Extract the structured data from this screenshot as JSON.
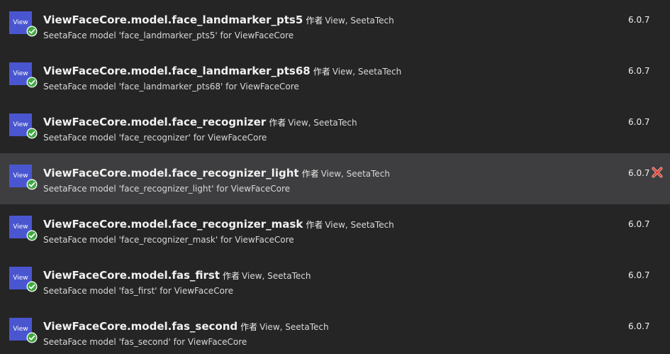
{
  "packages": [
    {
      "logo_text": "View",
      "name": "ViewFaceCore.model.face_landmarker_pts5",
      "by_label": "作者",
      "authors": "View, SeetaTech",
      "description": "SeetaFace model 'face_landmarker_pts5' for ViewFaceCore",
      "version": "6.0.7"
    },
    {
      "logo_text": "View",
      "name": "ViewFaceCore.model.face_landmarker_pts68",
      "by_label": "作者",
      "authors": "View, SeetaTech",
      "description": "SeetaFace model 'face_landmarker_pts68' for ViewFaceCore",
      "version": "6.0.7"
    },
    {
      "logo_text": "View",
      "name": "ViewFaceCore.model.face_recognizer",
      "by_label": "作者",
      "authors": "View, SeetaTech",
      "description": "SeetaFace model 'face_recognizer' for ViewFaceCore",
      "version": "6.0.7"
    },
    {
      "logo_text": "View",
      "name": "ViewFaceCore.model.face_recognizer_light",
      "by_label": "作者",
      "authors": "View, SeetaTech",
      "description": "SeetaFace model 'face_recognizer_light' for ViewFaceCore",
      "version": "6.0.7"
    },
    {
      "logo_text": "View",
      "name": "ViewFaceCore.model.face_recognizer_mask",
      "by_label": "作者",
      "authors": "View, SeetaTech",
      "description": "SeetaFace model 'face_recognizer_mask' for ViewFaceCore",
      "version": "6.0.7"
    },
    {
      "logo_text": "View",
      "name": "ViewFaceCore.model.fas_first",
      "by_label": "作者",
      "authors": "View, SeetaTech",
      "description": "SeetaFace model 'fas_first' for ViewFaceCore",
      "version": "6.0.7"
    },
    {
      "logo_text": "View",
      "name": "ViewFaceCore.model.fas_second",
      "by_label": "作者",
      "authors": "View, SeetaTech",
      "description": "SeetaFace model 'fas_second' for ViewFaceCore",
      "version": "6.0.7"
    }
  ],
  "hovered_package": "ViewFaceCore.model.face_recognizer_light",
  "icons": {
    "installed": "installed-check-icon",
    "uninstall": "uninstall-x-icon"
  },
  "colors": {
    "background": "#252526",
    "hover_background": "#3e3e40",
    "logo_background": "#4a56d0",
    "installed_check": "#3fa83f",
    "uninstall_x": "#d9453a"
  }
}
